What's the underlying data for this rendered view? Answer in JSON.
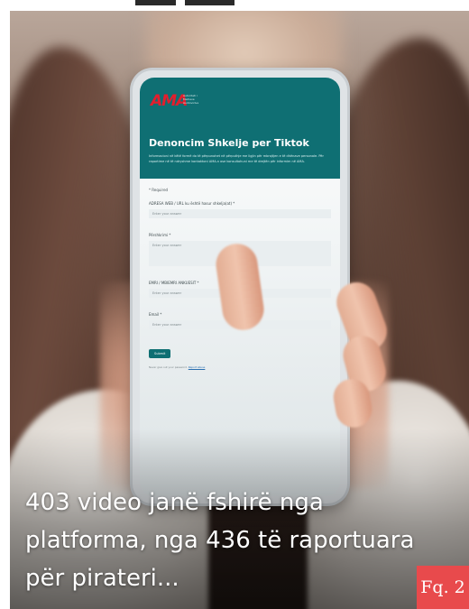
{
  "phone_form": {
    "logo": "AMA",
    "logo_subtitle": "Autoriteti i Mediave Audiovizive",
    "title": "Denoncim Shkelje per Tiktok",
    "description": "Informacioni në këtë formë do të përpunohet në përputhje me ligjin për mbrojtjen e të dhënave personale. Për raportime në të ndryshme kontaktoni AMA-n ose konsultohuni me të drejtën për informim në AMA.",
    "required_note": "* Required",
    "questions": [
      {
        "label": "ADRESA WEB / URL ku është hasur shkelja(at) *",
        "placeholder": "Enter your answer"
      },
      {
        "label": "Përshkrimi *",
        "placeholder": "Enter your answer"
      },
      {
        "label": "EMRI / MBIEMRI ANKUESIT *",
        "placeholder": "Enter your answer"
      },
      {
        "label": "Email *",
        "placeholder": "Enter your answer"
      }
    ],
    "submit_label": "Submit",
    "policy_text": "Never give out your password.",
    "policy_link": "Report abuse"
  },
  "headline": "403 video janë fshirë nga platforma, nga 436 të raportuara për pirateri...",
  "badge": "Fq. 2",
  "colors": {
    "form_header": "#0f6f73",
    "badge": "#e84a4c",
    "logo": "#e31e2d"
  }
}
